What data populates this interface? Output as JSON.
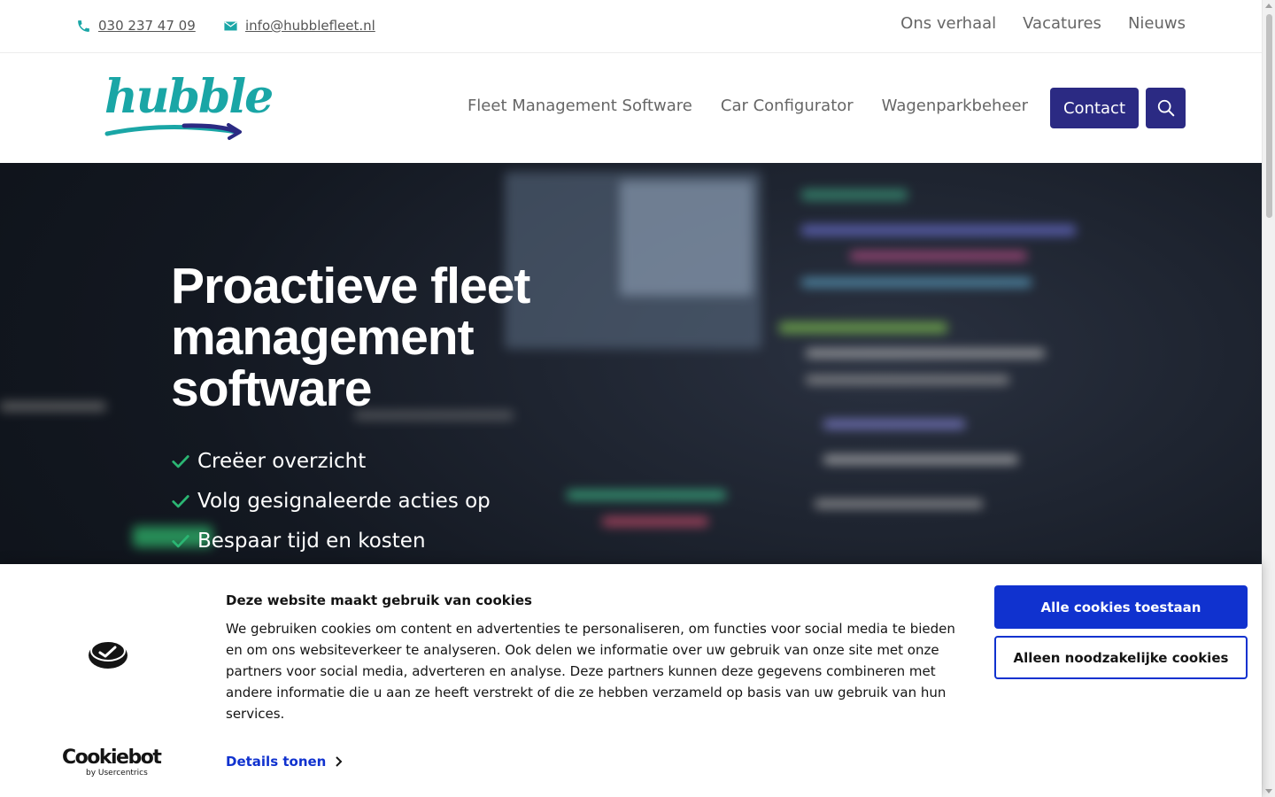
{
  "topbar": {
    "phone": "030 237 47 09",
    "email": "info@hubblefleet.nl",
    "links": [
      "Ons verhaal",
      "Vacatures",
      "Nieuws"
    ]
  },
  "header": {
    "logo_text": "hubble",
    "nav": [
      "Fleet Management Software",
      "Car Configurator",
      "Wagenparkbeheer"
    ],
    "contact_label": "Contact",
    "search_icon": "search-icon"
  },
  "hero": {
    "title": "Proactieve fleet management software",
    "checks": [
      "Creëer overzicht",
      "Volg gesignaleerde acties op",
      "Bespaar tijd en kosten"
    ]
  },
  "cookie": {
    "title": "Deze website maakt gebruik van cookies",
    "text": "We gebruiken cookies om content en advertenties te personaliseren, om functies voor social media te bieden en om ons websiteverkeer te analyseren. Ook delen we informatie over uw gebruik van onze site met onze partners voor social media, adverteren en analyse. Deze partners kunnen deze gegevens combineren met andere informatie die u aan ze heeft verstrekt of die ze hebben verzameld op basis van uw gebruik van hun services.",
    "details_label": "Details tonen",
    "allow_all_label": "Alle cookies toestaan",
    "necessary_label": "Alleen noodzakelijke cookies",
    "brand_name": "Cookiebot",
    "brand_sub": "by Usercentrics"
  },
  "colors": {
    "brand_primary": "#2b2a83",
    "brand_teal": "#1aa6a6",
    "check_green": "#2bb673",
    "cookie_blue": "#1032cf"
  }
}
